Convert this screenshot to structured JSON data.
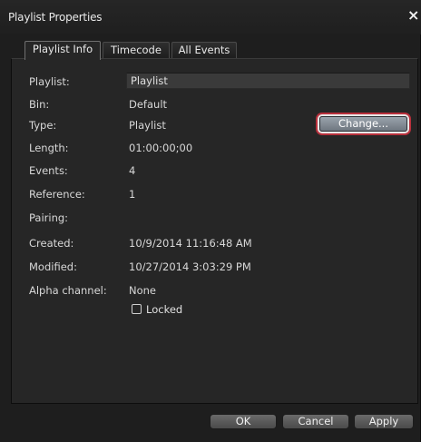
{
  "window": {
    "title": "Playlist Properties",
    "close_glyph": "×"
  },
  "tabs": [
    {
      "label": "Playlist Info",
      "active": true
    },
    {
      "label": "Timecode",
      "active": false
    },
    {
      "label": "All Events",
      "active": false
    }
  ],
  "fields": {
    "playlist": {
      "label": "Playlist:",
      "value": "Playlist"
    },
    "bin": {
      "label": "Bin:",
      "value": "Default"
    },
    "type": {
      "label": "Type:",
      "value": "Playlist"
    },
    "length": {
      "label": "Length:",
      "value": "01:00:00;00"
    },
    "events": {
      "label": "Events:",
      "value": "4"
    },
    "reference": {
      "label": "Reference:",
      "value": "1"
    },
    "pairing": {
      "label": "Pairing:",
      "value": ""
    },
    "created": {
      "label": "Created:",
      "value": "10/9/2014 11:16:48 AM"
    },
    "modified": {
      "label": "Modified:",
      "value": "10/27/2014 3:03:29 PM"
    },
    "alpha": {
      "label": "Alpha channel:",
      "value": "None"
    }
  },
  "locked": {
    "label": "Locked",
    "checked": false
  },
  "change_button": "Change...",
  "footer": {
    "ok": "OK",
    "cancel": "Cancel",
    "apply": "Apply"
  },
  "colors": {
    "background": "#1e1e1e",
    "panel": "#262626",
    "text": "#d8d8d8",
    "highlight_ring": "#b8303c"
  }
}
